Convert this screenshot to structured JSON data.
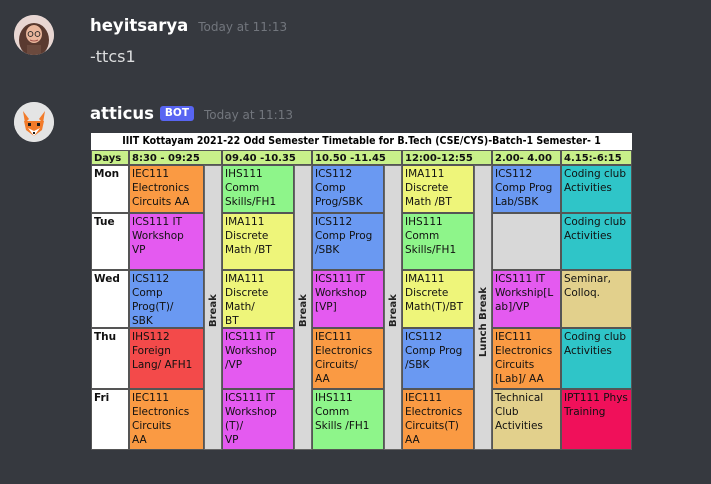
{
  "messages": [
    {
      "username": "heyitsarya",
      "timestamp": "Today at 11:13",
      "text": "-ttcs1"
    },
    {
      "username": "atticus",
      "badge": "BOT",
      "timestamp": "Today at 11:13"
    }
  ],
  "timetable": {
    "title": "IIIT Kottayam 2021-22 Odd Semester Timetable for B.Tech (CSE/CYS)-Batch-1 Semester- 1",
    "headers": [
      "Days",
      "8:30 - 09:25",
      "09.40 -10.35",
      "10.50 -11.45",
      "12:00-12:55",
      "2.00- 4.00",
      "4.15:-6:15"
    ],
    "break_labels": [
      "Break",
      "Break",
      "Break",
      "Lunch Break"
    ],
    "rows": [
      {
        "day": "Mon",
        "cells": [
          {
            "text": "IEC111\nElectronics\nCircuits AA",
            "color": "#fa9a43"
          },
          {
            "text": "IHS111 Comm\nSkills/FH1",
            "color": "#8ef58a"
          },
          {
            "text": "ICS112\nComp\nProg/SBK",
            "color": "#6a99f2"
          },
          {
            "text": "IMA111\nDiscrete\nMath /BT",
            "color": "#eef57a"
          },
          {
            "text": "ICS112\nComp Prog\nLab/SBK",
            "color": "#6a99f2"
          },
          {
            "text": "Coding club\nActivities",
            "color": "#2fc5c8"
          }
        ]
      },
      {
        "day": "Tue",
        "cells": [
          {
            "text": "ICS111 IT\nWorkshop\nVP",
            "color": "#e45af0"
          },
          {
            "text": "IMA111\nDiscrete\nMath /BT",
            "color": "#eef57a"
          },
          {
            "text": "ICS112\nComp Prog\n/SBK",
            "color": "#6a99f2"
          },
          {
            "text": "IHS111\nComm\nSkills/FH1",
            "color": "#8ef58a"
          },
          {
            "text": "",
            "color": "#d8d8d8"
          },
          {
            "text": "Coding club\nActivities",
            "color": "#2fc5c8"
          }
        ]
      },
      {
        "day": "Wed",
        "cells": [
          {
            "text": "ICS112 Comp\nProg(T)/\nSBK",
            "color": "#6a99f2"
          },
          {
            "text": "IMA111\nDiscrete\nMath/\nBT",
            "color": "#eef57a"
          },
          {
            "text": "ICS111 IT\nWorkshop\n[VP]",
            "color": "#e45af0"
          },
          {
            "text": "IMA111\nDiscrete\nMath(T)/BT",
            "color": "#eef57a"
          },
          {
            "text": "ICS111 IT\nWorkship[L\nab]/VP",
            "color": "#e45af0"
          },
          {
            "text": "Seminar,\nColloq.",
            "color": "#e2d08c"
          }
        ]
      },
      {
        "day": "Thu",
        "cells": [
          {
            "text": "IHS112\nForeign\nLang/ AFH1",
            "color": "#f34a4a"
          },
          {
            "text": "ICS111 IT\nWorkshop\n/VP",
            "color": "#e45af0"
          },
          {
            "text": "IEC111\nElectronics\nCircuits/\nAA",
            "color": "#fa9a43"
          },
          {
            "text": "ICS112\nComp Prog\n/SBK",
            "color": "#6a99f2"
          },
          {
            "text": "IEC111\nElectronics\nCircuits\n[Lab]/ AA",
            "color": "#fa9a43"
          },
          {
            "text": "Coding club\nActivities",
            "color": "#2fc5c8"
          }
        ]
      },
      {
        "day": "Fri",
        "cells": [
          {
            "text": "IEC111\nElectronics\nCircuits\nAA",
            "color": "#fa9a43"
          },
          {
            "text": "ICS111 IT\nWorkshop\n(T)/\nVP",
            "color": "#e45af0"
          },
          {
            "text": "IHS111\nComm\nSkills /FH1",
            "color": "#8ef58a"
          },
          {
            "text": "IEC111\nElectronics\nCircuits(T)\nAA",
            "color": "#fa9a43"
          },
          {
            "text": "Technical\nClub\nActivities",
            "color": "#e2d08c"
          },
          {
            "text": "IPT111 Phys\nTraining",
            "color": "#f0105a"
          }
        ]
      }
    ]
  }
}
